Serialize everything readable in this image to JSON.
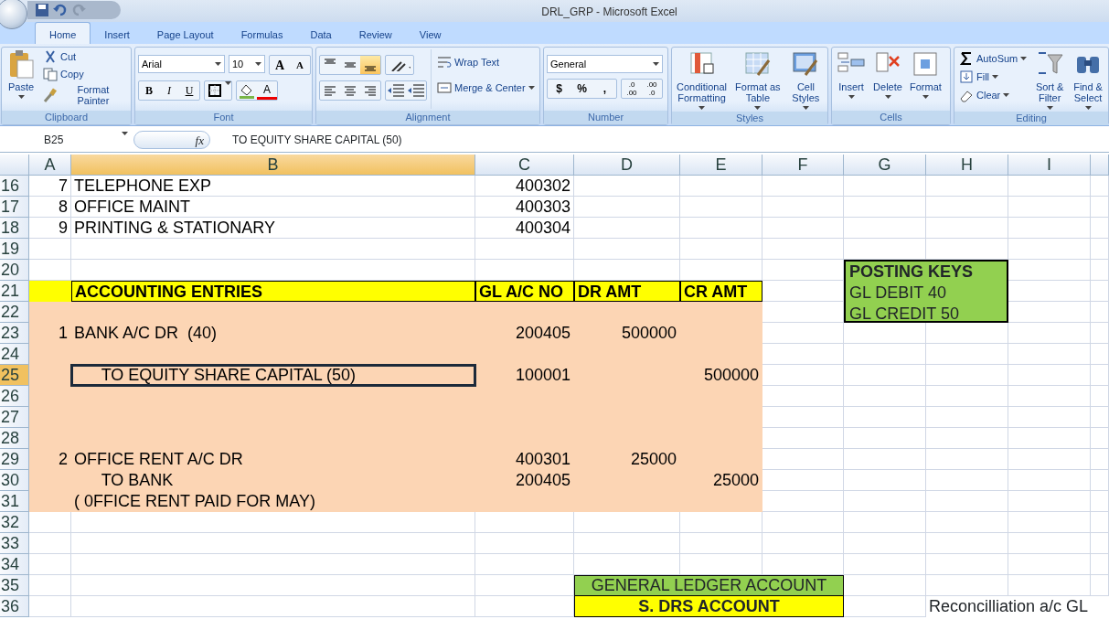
{
  "window": {
    "title": "DRL_GRP - Microsoft Excel"
  },
  "tabs": [
    {
      "label": "Home",
      "selected": true
    },
    {
      "label": "Insert",
      "selected": false
    },
    {
      "label": "Page Layout",
      "selected": false
    },
    {
      "label": "Formulas",
      "selected": false
    },
    {
      "label": "Data",
      "selected": false
    },
    {
      "label": "Review",
      "selected": false
    },
    {
      "label": "View",
      "selected": false
    }
  ],
  "ribbon": [
    {
      "kind": "clipboard",
      "label": "Clipboard",
      "paste": "Paste",
      "commands": [
        "Cut",
        "Copy",
        "Format Painter"
      ]
    },
    {
      "kind": "font",
      "label": "Font",
      "font_name": "Arial",
      "font_size": "10",
      "grow": "A",
      "shrink": "A",
      "styles": [
        "B",
        "I",
        "U"
      ],
      "font_color": "A"
    },
    {
      "kind": "alignment",
      "label": "Alignment",
      "vertical": [
        {
          "selected": false
        },
        {
          "selected": false
        },
        {
          "selected": true
        }
      ],
      "wrap": "Wrap Text",
      "merge": "Merge & Center"
    },
    {
      "kind": "number",
      "label": "Number",
      "format": "General",
      "symbols": [
        "$",
        "%",
        ","
      ],
      "decimals": [
        {
          "top": ".0",
          "bottom": ".00"
        },
        {
          "top": ".00",
          "bottom": ".0"
        }
      ]
    },
    {
      "kind": "styles",
      "label": "Styles",
      "commands": [
        "Conditional Formatting",
        "Format as Table",
        "Cell Styles"
      ]
    },
    {
      "kind": "cells",
      "label": "Cells",
      "commands": [
        "Insert",
        "Delete",
        "Format"
      ]
    },
    {
      "kind": "editing",
      "label": "Editing",
      "small": [
        "AutoSum",
        "Fill",
        "Clear"
      ],
      "large": [
        "Sort & Filter",
        "Find & Select"
      ]
    }
  ],
  "formula_bar": {
    "name_box": "B25",
    "fx": "fx",
    "formula": "TO EQUITY SHARE CAPITAL (50)"
  },
  "sheet": {
    "columns": [
      {
        "label": "A",
        "selected": false
      },
      {
        "label": "B",
        "selected": true
      },
      {
        "label": "C",
        "selected": false
      },
      {
        "label": "D",
        "selected": false
      },
      {
        "label": "E",
        "selected": false
      },
      {
        "label": "F",
        "selected": false
      },
      {
        "label": "G",
        "selected": false
      },
      {
        "label": "H",
        "selected": false
      },
      {
        "label": "I",
        "selected": false
      }
    ],
    "rows": [
      {
        "number": "16",
        "selected": false,
        "kind": "plain",
        "cells": [
          "7",
          "TELEPHONE EXP",
          "400302"
        ]
      },
      {
        "number": "17",
        "selected": false,
        "kind": "plain",
        "cells": [
          "8",
          "OFFICE MAINT",
          "400303"
        ]
      },
      {
        "number": "18",
        "selected": false,
        "kind": "plain",
        "cells": [
          "9",
          "PRINTING & STATIONARY",
          "400304"
        ]
      },
      {
        "number": "19",
        "selected": false,
        "kind": "plain"
      },
      {
        "number": "20",
        "selected": false,
        "kind": "plain",
        "key_panel": {
          "title": "POSTING KEYS",
          "lines": [
            "GL DEBIT 40",
            "GL CREDIT 50"
          ]
        }
      },
      {
        "number": "21",
        "selected": false,
        "kind": "header",
        "cells": [
          "",
          "ACCOUNTING ENTRIES",
          "GL A/C NO",
          "DR AMT",
          "CR AMT"
        ]
      },
      {
        "number": "22",
        "selected": false,
        "kind": "entry"
      },
      {
        "number": "23",
        "selected": false,
        "kind": "entry",
        "cells": [
          "1",
          "BANK A/C DR  (40)",
          "200405",
          "500000"
        ]
      },
      {
        "number": "24",
        "selected": false,
        "kind": "entry"
      },
      {
        "number": "25",
        "selected": true,
        "kind": "entry",
        "cells": [
          "",
          "      TO EQUITY SHARE CAPITAL (50)",
          "100001",
          "",
          "500000"
        ]
      },
      {
        "number": "26",
        "selected": false,
        "kind": "entry"
      },
      {
        "number": "27",
        "selected": false,
        "kind": "entry"
      },
      {
        "number": "28",
        "selected": false,
        "kind": "entry"
      },
      {
        "number": "29",
        "selected": false,
        "kind": "entry",
        "cells": [
          "2",
          "OFFICE RENT A/C DR",
          "400301",
          "25000"
        ]
      },
      {
        "number": "30",
        "selected": false,
        "kind": "entry",
        "cells": [
          "",
          "      TO BANK",
          "200405",
          "",
          "25000"
        ]
      },
      {
        "number": "31",
        "selected": false,
        "kind": "entry",
        "cells": [
          "",
          "( 0FFICE RENT PAID FOR MAY)"
        ]
      },
      {
        "number": "32",
        "selected": false,
        "kind": "plain"
      },
      {
        "number": "33",
        "selected": false,
        "kind": "plain"
      },
      {
        "number": "34",
        "selected": false,
        "kind": "plain"
      },
      {
        "number": "35",
        "selected": false,
        "kind": "plain",
        "ledger": {
          "title": "GENERAL LEDGER ACCOUNT",
          "subtitle": "S. DRS ACCOUNT"
        }
      },
      {
        "number": "36",
        "selected": false,
        "kind": "plain",
        "note": "Reconcilliation a/c  GL"
      }
    ]
  }
}
